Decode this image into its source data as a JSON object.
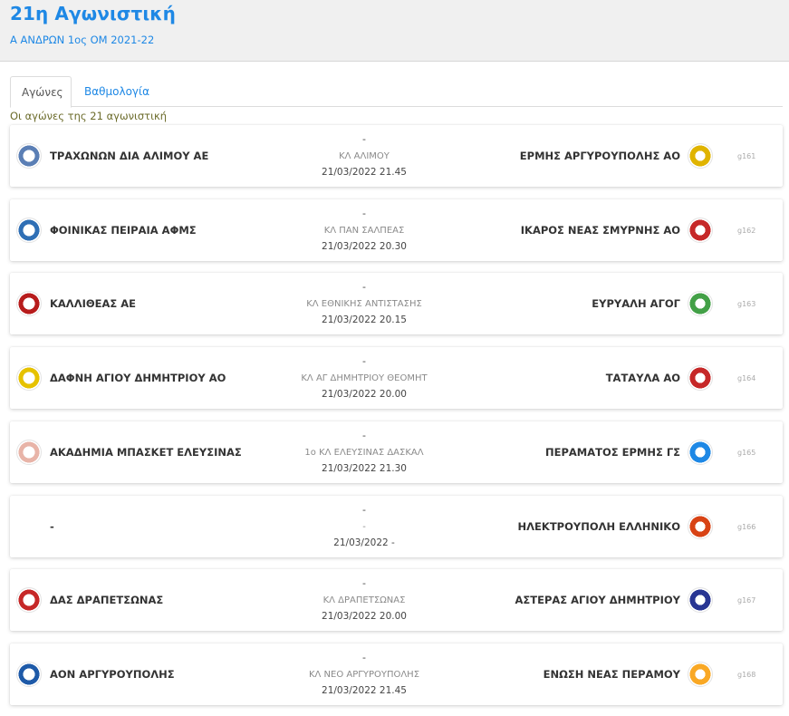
{
  "header": {
    "title": "21η Αγωνιστική",
    "subtitle": "Α ΑΝΔΡΩΝ 1ος ΟΜ 2021-22"
  },
  "tabs": [
    {
      "label": "Αγώνες",
      "active": true
    },
    {
      "label": "Βαθμολογία",
      "active": false
    }
  ],
  "intro": "Οι αγώνες της 21 αγωνιστική",
  "matches": [
    {
      "home": "ΤΡΑΧΩΝΩΝ ΔΙΑ ΑΛΙΜΟΥ ΑΕ",
      "home_logo": "trachones-logo",
      "home_color": "#5b7fb5",
      "score": "-",
      "venue": "ΚΛ ΑΛΙΜΟΥ",
      "datetime": "21/03/2022 21.45",
      "away": "ΕΡΜΗΣ ΑΡΓΥΡΟΥΠΟΛΗΣ ΑΟ",
      "away_logo": "ermis-argyroupolis-logo",
      "away_color": "#e0b400",
      "code": "g161"
    },
    {
      "home": "ΦΟΙΝΙΚΑΣ ΠΕΙΡΑΙΑ ΑΦΜΣ",
      "home_logo": "foinikas-peiraia-logo",
      "home_color": "#2f6fb5",
      "score": "-",
      "venue": "ΚΛ ΠΑΝ ΣΑΛΠΕΑΣ",
      "datetime": "21/03/2022 20.30",
      "away": "ΙΚΑΡΟΣ ΝΕΑΣ ΣΜΥΡΝΗΣ ΑΟ",
      "away_logo": "ikaros-logo",
      "away_color": "#c62828",
      "code": "g162"
    },
    {
      "home": "ΚΑΛΛΙΘΕΑΣ ΑΕ",
      "home_logo": "kallithea-logo",
      "home_color": "#b71c1c",
      "score": "-",
      "venue": "ΚΛ ΕΘΝΙΚΗΣ ΑΝΤΙΣΤΑΣΗΣ",
      "datetime": "21/03/2022 20.15",
      "away": "ΕΥΡΥΑΛΗ ΑΓΟΓ",
      "away_logo": "evryali-logo",
      "away_color": "#43a047",
      "code": "g163"
    },
    {
      "home": "ΔΑΦΝΗ ΑΓΙΟΥ ΔΗΜΗΤΡΙΟΥ ΑΟ",
      "home_logo": "dafni-logo",
      "home_color": "#e6c200",
      "score": "-",
      "venue": "ΚΛ ΑΓ ΔΗΜΗΤΡΙΟΥ ΘΕΟΜΗΤ",
      "datetime": "21/03/2022 20.00",
      "away": "ΤΑΤΑΥΛΑ ΑΟ",
      "away_logo": "tatavla-logo",
      "away_color": "#c62828",
      "code": "g164"
    },
    {
      "home": "ΑΚΑΔΗΜΙΑ ΜΠΑΣΚΕΤ ΕΛΕΥΣΙΝΑΣ",
      "home_logo": "akadimia-elefsinas-logo",
      "home_color": "#e8b4a8",
      "score": "-",
      "venue": "1ο ΚΛ ΕΛΕΥΣΙΝΑΣ ΔΑΣΚΑΛ",
      "datetime": "21/03/2022 21.30",
      "away": "ΠΕΡΑΜΑΤΟΣ ΕΡΜΗΣ ΓΣ",
      "away_logo": "peramatos-ermis-logo",
      "away_color": "#1e88e5",
      "code": "g165"
    },
    {
      "home": "-",
      "home_logo": "",
      "home_color": "",
      "score": "-",
      "venue": "-",
      "datetime": "21/03/2022 -",
      "away": "ΗΛΕΚΤΡΟΥΠΟΛΗ ΕΛΛΗΝΙΚΟ",
      "away_logo": "ilektroupoli-logo",
      "away_color": "#d84315",
      "code": "g166"
    },
    {
      "home": "ΔΑΣ ΔΡΑΠΕΤΣΩΝΑΣ",
      "home_logo": "das-drapetsonas-logo",
      "home_color": "#c62828",
      "score": "-",
      "venue": "ΚΛ ΔΡΑΠΕΤΣΩΝΑΣ",
      "datetime": "21/03/2022 20.00",
      "away": "ΑΣΤΕΡΑΣ ΑΓΙΟΥ ΔΗΜΗΤΡΙΟΥ",
      "away_logo": "asteras-logo",
      "away_color": "#283593",
      "code": "g167"
    },
    {
      "home": "ΑΟΝ ΑΡΓΥΡΟΥΠΟΛΗΣ",
      "home_logo": "aon-argyroupolis-logo",
      "home_color": "#1e5aa8",
      "score": "-",
      "venue": "ΚΛ ΝΕΟ ΑΡΓΥΡΟΥΠΟΛΗΣ",
      "datetime": "21/03/2022 21.45",
      "away": "ΕΝΩΣΗ ΝΕΑΣ ΠΕΡΑΜΟΥ",
      "away_logo": "enosi-peramou-logo",
      "away_color": "#f9a825",
      "code": "g168"
    }
  ]
}
